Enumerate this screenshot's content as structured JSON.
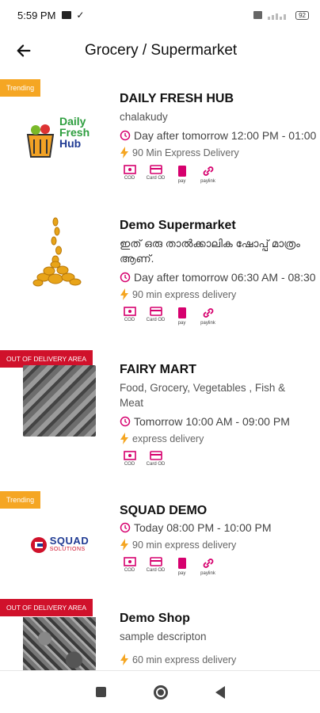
{
  "status_bar": {
    "time": "5:59 PM",
    "battery": "92"
  },
  "header": {
    "title": "Grocery / Supermarket"
  },
  "stores": [
    {
      "tag": "Trending",
      "name": "DAILY FRESH HUB",
      "description": "chalakudy",
      "hours": "Day after tomorrow 12:00 PM - 01:00",
      "delivery": "90 Min Express Delivery",
      "logo_text": [
        "Daily",
        "Fresh",
        "Hub"
      ],
      "payments": [
        "COD",
        "Card OD",
        "pay",
        "paylink"
      ]
    },
    {
      "tag": "",
      "name": "Demo Supermarket",
      "description": "ഇത് ഒരു താൽക്കാലിക ഷോപ്പ് മാത്രം ആണ്.",
      "hours": "Day after tomorrow 06:30 AM - 08:30",
      "delivery": "90 min express delivery",
      "payments": [
        "COD",
        "Card OD",
        "pay",
        "paylink"
      ]
    },
    {
      "tag": "OUT OF DELIVERY AREA",
      "name": "FAIRY MART",
      "description": "Food, Grocery, Vegetables , Fish & Meat",
      "hours": "Tomorrow 10:00 AM - 09:00 PM",
      "delivery": "express delivery",
      "payments": [
        "COD",
        "Card OD"
      ]
    },
    {
      "tag": "Trending",
      "name": "SQUAD DEMO",
      "description": "",
      "hours": "Today 08:00 PM - 10:00 PM",
      "delivery": "90 min express delivery",
      "logo_text": [
        "SQUAD",
        "SOLUTIONS"
      ],
      "payments": [
        "COD",
        "Card OD",
        "pay",
        "paylink"
      ]
    },
    {
      "tag": "OUT OF DELIVERY AREA",
      "name": "Demo Shop",
      "description": "sample descripton",
      "hours": "",
      "delivery": "60 min express delivery",
      "payments": []
    }
  ],
  "colors": {
    "accent": "#d6006e",
    "trending": "#f5a623",
    "out_of_area": "#d0112b",
    "bolt": "#f5a623"
  }
}
